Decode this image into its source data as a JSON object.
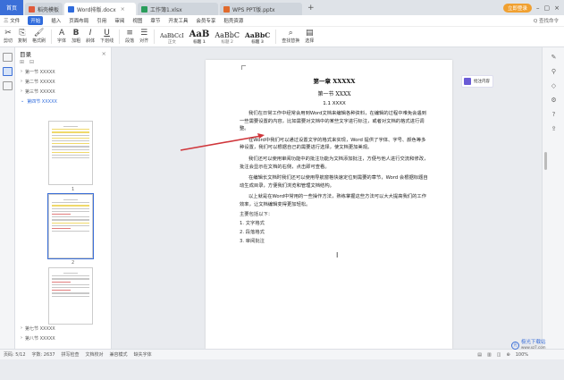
{
  "tabs": {
    "home": "首页",
    "items": [
      {
        "label": "稻壳模板",
        "color": "#e05a3a"
      },
      {
        "label": "Word排版.docx",
        "color": "#2f6bdc",
        "active": true
      },
      {
        "label": "工作簿1.xlsx",
        "color": "#2a9d5b"
      },
      {
        "label": "WPS PPT版.pptx",
        "color": "#e06a2c"
      }
    ],
    "add": "+",
    "login": "立即登录"
  },
  "menu": {
    "items": [
      "三 文件",
      "开始",
      "插入",
      "页面布局",
      "引用",
      "审阅",
      "视图",
      "章节",
      "开发工具",
      "会员专享",
      "稻壳资源"
    ],
    "active_index": 1,
    "search": "Q 查找命令"
  },
  "ribbon": {
    "buttons": [
      {
        "glyph": "✂",
        "label": "剪切"
      },
      {
        "glyph": "⎘",
        "label": "复制"
      },
      {
        "glyph": "🖌",
        "label": "格式刷"
      },
      {
        "glyph": "A",
        "label": "字体"
      },
      {
        "glyph": "B",
        "label": "加粗"
      },
      {
        "glyph": "I",
        "label": "斜体"
      },
      {
        "glyph": "U",
        "label": "下划线"
      },
      {
        "glyph": "≡",
        "label": "段落"
      },
      {
        "glyph": "☰",
        "label": "对齐"
      }
    ],
    "styles": [
      {
        "sample": "AaBbCcI",
        "name": "正文"
      },
      {
        "sample": "AaB",
        "name": "标题 1"
      },
      {
        "sample": "AaBbC",
        "name": "标题 2"
      },
      {
        "sample": "AaBbC",
        "name": "标题 3"
      }
    ],
    "tail": [
      {
        "glyph": "⌕",
        "label": "查找替换"
      },
      {
        "glyph": "▤",
        "label": "选择"
      }
    ]
  },
  "nav": {
    "title": "目录",
    "items": [
      {
        "label": "第一节 XXXXX",
        "selected": false
      },
      {
        "label": "第二节 XXXXX",
        "selected": false
      },
      {
        "label": "第三节 XXXXX",
        "selected": false
      },
      {
        "label": "第四节 XXXXX",
        "selected": true
      }
    ],
    "bottom_items": [
      "第七节 XXXXX",
      "第八节 XXXXX"
    ],
    "page_labels": [
      "1",
      "2"
    ]
  },
  "document": {
    "chapter": "第一章 XXXXX",
    "section": "第一节 XXXX",
    "subsection": "1.1 XXXX",
    "paragraphs": [
      "我们在日常工作中经常会用到Word文档来编辑各种资料，在编辑的过程中难免会遇到一些需要设置的内容，比如需要对文档中的某些文字进行标注，或者对文档的格式进行调整。",
      "在Word中我们可以通过设置文字的格式来实现，Word 提供了字体、字号、颜色等多种设置，我们可以根据自己的需要进行选择，使文档更加美观。",
      "我们还可以使用审阅功能中的批注功能为文档添加批注，方便与他人进行交流和修改，批注会显示在文档的右侧，点击即可查看。",
      "在编辑长文档时我们还可以使用导航窗格快速定位到需要的章节，Word 会根据标题自动生成目录，方便我们浏览和管理文档结构。",
      "以上就是在Word中常用的一些操作方法，熟练掌握这些方法可以大大提高我们的工作效率，让文档编辑变得更加轻松。"
    ],
    "list_intro": "主要包括以下：",
    "list": [
      "1. 文字格式",
      "2. 段落格式",
      "3. 审阅批注"
    ]
  },
  "comment": {
    "text": "批注内容"
  },
  "status": {
    "items": [
      "页码: 5/12",
      "字数: 2637",
      "拼写检查",
      "文档校对",
      "兼容模式",
      "缺失字体"
    ],
    "right": [
      "▤",
      "▥",
      "◫",
      "⊕",
      "100%"
    ]
  },
  "watermark": {
    "title": "极光下载站",
    "sub": "www.xz7.com",
    "logo": "光"
  },
  "colors": {
    "accent": "#2f6bdc",
    "arrow": "#d0363b",
    "highlight": "#f4e046"
  }
}
